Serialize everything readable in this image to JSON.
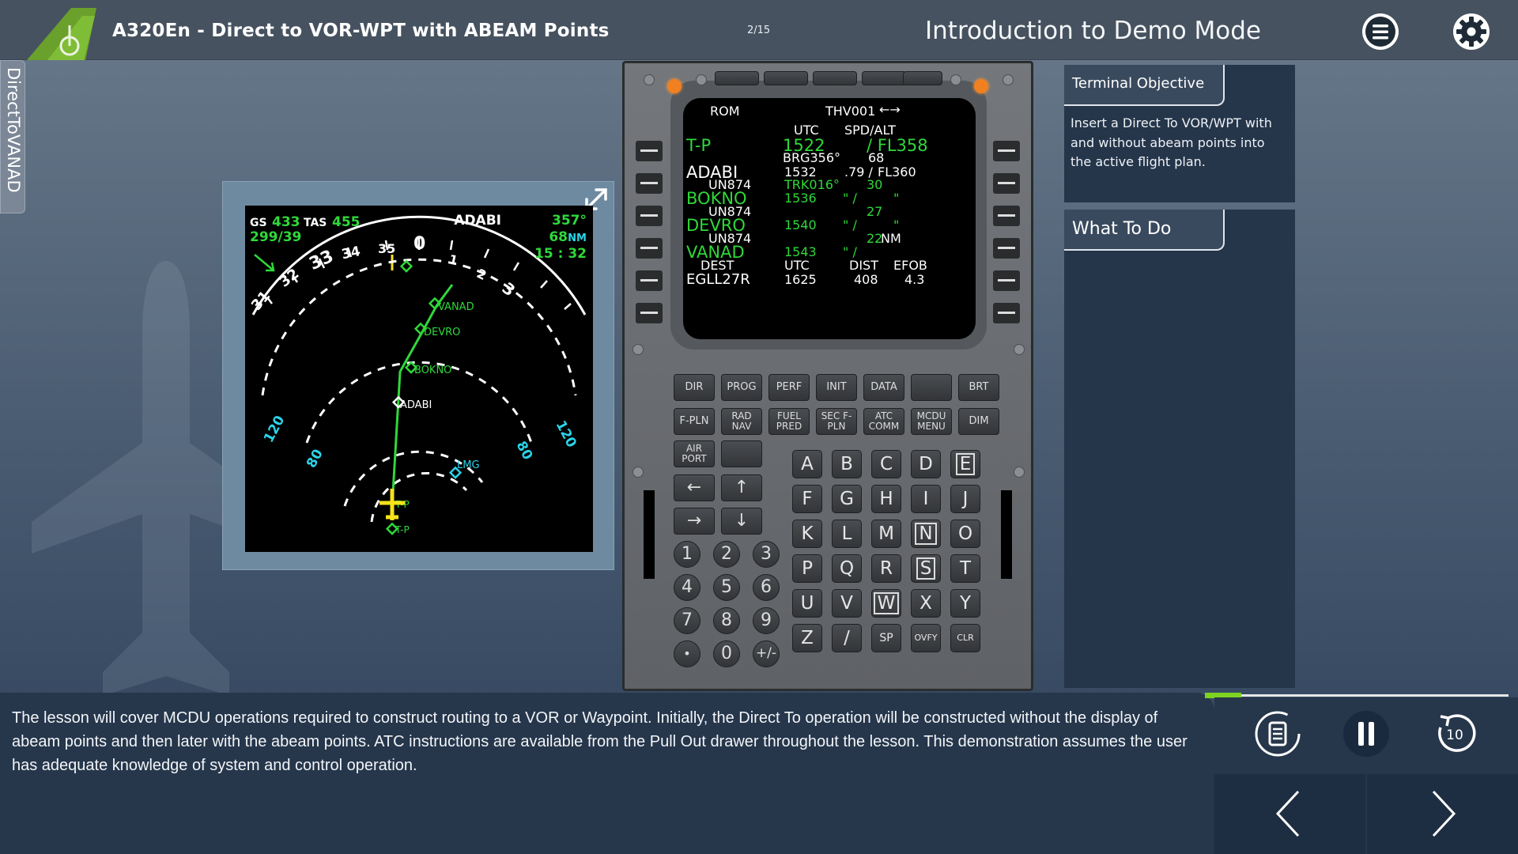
{
  "header": {
    "course_title": "A320En - Direct to VOR-WPT with ABEAM Points",
    "page_counter": "2/15",
    "section_title": "Introduction to Demo Mode",
    "menu_icon": "hamburger-menu-icon",
    "settings_icon": "gear-icon"
  },
  "side_tab": {
    "label": "DirectToVANAD"
  },
  "nd": {
    "gs_label": "GS",
    "gs_value": "433",
    "tas_label": "TAS",
    "tas_value": "455",
    "wind": "299/39",
    "waypoint": "ADABI",
    "bearing": "357°",
    "distance": "68",
    "distance_unit": "NM",
    "eta": "15 : 32",
    "heading_ticks": [
      "31",
      "32",
      "33",
      "34",
      "35",
      "0",
      "1",
      "2",
      "3"
    ],
    "range_labels": [
      "120",
      "80",
      "80",
      "120"
    ],
    "waypoints": [
      "VANAD",
      "DEVRO",
      "BOKNO",
      "ADABI",
      "LMG",
      "T-P",
      "T-P"
    ]
  },
  "mcdu": {
    "header_left": "ROM",
    "header_right": "THV001",
    "col_utc": "UTC",
    "col_spdalt": "SPD/ALT",
    "rows": {
      "r1_wpt": "T-P",
      "r1_utc": "1522",
      "r1_alt": "/ FL358",
      "r1_brg": "BRG356°",
      "r1_dist": "68",
      "r2_wpt": "ADABI",
      "r2_utc": "1532",
      "r2_spd": ".79 /",
      "r2_alt": "FL360",
      "r2_airway": "UN874",
      "r2_trk": "TRK016°",
      "r2_dist": "30",
      "r3_wpt": "BOKNO",
      "r3_utc": "1536",
      "r3_spd": "\"   /",
      "r3_alt": "\"",
      "r3_airway": "UN874",
      "r3_dist": "27",
      "r4_wpt": "DEVRO",
      "r4_utc": "1540",
      "r4_spd": "\"   /",
      "r4_alt": "\"",
      "r4_airway": "UN874",
      "r4_dist": "22",
      "r4_unit": "NM",
      "r5_wpt": "VANAD",
      "r5_utc": "1543",
      "r5_spd": "\"   /",
      "dest_label": "DEST",
      "utc_label": "UTC",
      "dist_label": "DIST",
      "efob_label": "EFOB",
      "dest_val": "EGLL27R",
      "dest_utc": "1625",
      "dest_dist": "408",
      "dest_efob": "4.3"
    },
    "function_keys": {
      "dir": "DIR",
      "prog": "PROG",
      "perf": "PERF",
      "init": "INIT",
      "data": "DATA",
      "brt": "BRT",
      "fpln": "F-PLN",
      "radnav": "RAD NAV",
      "fuelpred": "FUEL PRED",
      "secfpln": "SEC F-PLN",
      "atccomm": "ATC COMM",
      "mcdumenu": "MCDU MENU",
      "dim": "DIM",
      "airport": "AIR PORT"
    },
    "arrows": [
      "←",
      "↑",
      "→",
      "↓"
    ],
    "alpha_keys": [
      "A",
      "B",
      "C",
      "D",
      "E",
      "F",
      "G",
      "H",
      "I",
      "J",
      "K",
      "L",
      "M",
      "N",
      "O",
      "P",
      "Q",
      "R",
      "S",
      "T",
      "U",
      "V",
      "W",
      "X",
      "Y",
      "Z",
      "/",
      "SP",
      "OVFY",
      "CLR"
    ],
    "num_keys": [
      "1",
      "2",
      "3",
      "4",
      "5",
      "6",
      "7",
      "8",
      "9",
      "•",
      "0",
      "+/-"
    ]
  },
  "objective": {
    "tab": "Terminal Objective",
    "text": "Insert a Direct To VOR/WPT with and without abeam points into the active flight plan."
  },
  "what_to_do": {
    "tab": "What To Do"
  },
  "narration": {
    "text": "The lesson will cover MCDU operations required to construct routing to a VOR or Waypoint. Initially, the Direct To operation will be constructed without the display of abeam points and then later with the abeam points. ATC instructions are available from the Pull Out drawer throughout the lesson. This demonstration assumes the user has adequate knowledge of system and control operation."
  },
  "controls": {
    "progress": 0.12,
    "transcript_icon": "transcript-icon",
    "pause_icon": "pause-icon",
    "replay_icon": "replay-10-icon",
    "replay_label": "10",
    "prev_icon": "chevron-left-icon",
    "next_icon": "chevron-right-icon"
  },
  "colors": {
    "accent_green": "#7ed321",
    "mcdu_green": "#2fd83a",
    "nd_cyan": "#2ad4e8",
    "nd_yellow": "#f5e21a"
  }
}
